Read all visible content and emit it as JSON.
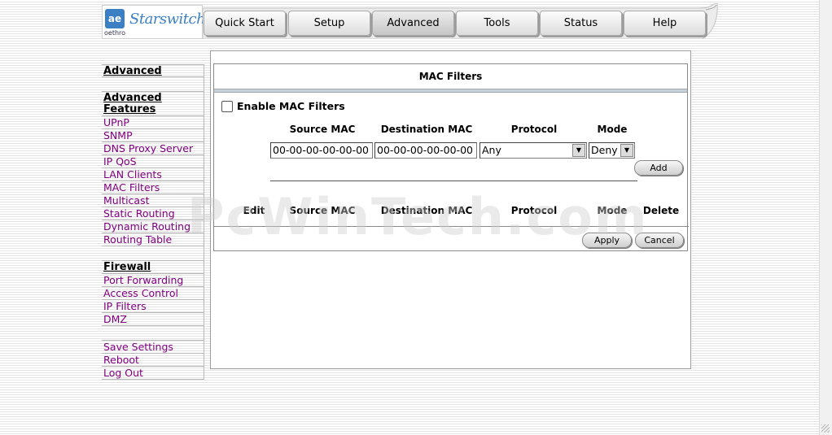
{
  "logo": {
    "mark": "ae",
    "sub": "oethro",
    "text": "Starswitch"
  },
  "nav": {
    "tabs": [
      {
        "label": "Quick Start"
      },
      {
        "label": "Setup"
      },
      {
        "label": "Advanced",
        "active": true
      },
      {
        "label": "Tools"
      },
      {
        "label": "Status"
      },
      {
        "label": "Help"
      }
    ]
  },
  "sidebar": {
    "advanced_heading": "Advanced",
    "advanced_features_heading": "Advanced Features",
    "advanced_items": [
      "UPnP",
      "SNMP",
      "DNS Proxy Server",
      "IP QoS",
      "LAN Clients",
      "MAC Filters",
      "Multicast",
      "Static Routing",
      "Dynamic Routing",
      "Routing Table"
    ],
    "firewall_heading": "Firewall",
    "firewall_items": [
      "Port Forwarding",
      "Access Control",
      "IP Filters",
      "DMZ"
    ],
    "bottom_items": [
      "Save Settings",
      "Reboot",
      "Log Out"
    ]
  },
  "mac_filters": {
    "title": "MAC Filters",
    "enable_label": "Enable MAC Filters",
    "enabled": false,
    "form": {
      "headers": {
        "source": "Source MAC",
        "destination": "Destination MAC",
        "protocol": "Protocol",
        "mode": "Mode"
      },
      "source_value": "00-00-00-00-00-00",
      "destination_value": "00-00-00-00-00-00",
      "protocol_value": "Any",
      "mode_value": "Deny",
      "add_label": "Add"
    },
    "table": {
      "headers": {
        "edit": "Edit",
        "source": "Source MAC",
        "destination": "Destination MAC",
        "protocol": "Protocol",
        "mode": "Mode",
        "delete": "Delete"
      }
    },
    "apply_label": "Apply",
    "cancel_label": "Cancel"
  },
  "watermark": "PcWinTech.com",
  "icons": {
    "dropdown": "chevron-down-icon"
  },
  "colors": {
    "visited_link": "#800080",
    "panel_separator": "#c8d0d8",
    "logo_blue": "#3b7fc4"
  }
}
